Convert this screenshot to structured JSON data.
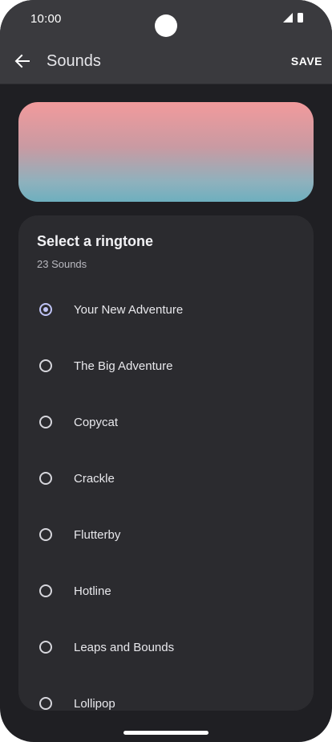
{
  "status_bar": {
    "time": "10:00",
    "icons": [
      "signal-icon",
      "battery-icon"
    ]
  },
  "app_bar": {
    "back_icon": "arrow-left-icon",
    "title": "Sounds",
    "save_label": "SAVE"
  },
  "preview": {
    "gradient_colors": [
      "#f29a9c",
      "#6eafbe"
    ]
  },
  "ringtones": {
    "title": "Select a ringtone",
    "count_label": "23 Sounds",
    "selected_index": 0,
    "items": [
      {
        "label": "Your New Adventure",
        "selected": true
      },
      {
        "label": "The Big Adventure",
        "selected": false
      },
      {
        "label": "Copycat",
        "selected": false
      },
      {
        "label": "Crackle",
        "selected": false
      },
      {
        "label": "Flutterby",
        "selected": false
      },
      {
        "label": "Hotline",
        "selected": false
      },
      {
        "label": "Leaps and Bounds",
        "selected": false
      },
      {
        "label": "Lollipop",
        "selected": false
      }
    ]
  },
  "colors": {
    "background": "#1f1f23",
    "app_bar": "#3a3a3e",
    "card": "#2b2b2f",
    "accent": "#bfc3f5"
  }
}
